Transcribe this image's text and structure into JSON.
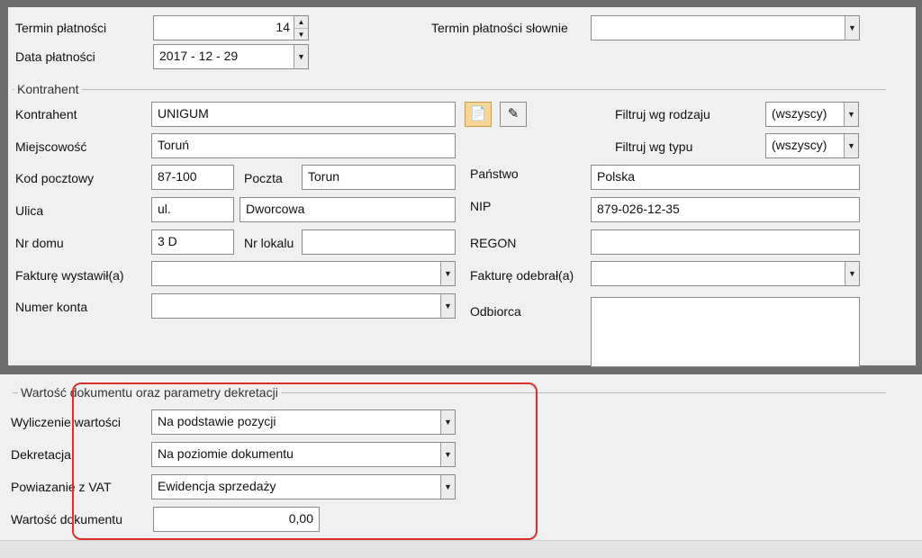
{
  "payment": {
    "term_label": "Termin płatności",
    "term_value": "14",
    "term_words_label": "Termin płatności słownie",
    "term_words_value": "",
    "date_label": "Data płatności",
    "date_value": "2017 - 12 - 29"
  },
  "contractor": {
    "group_title": "Kontrahent",
    "name_label": "Kontrahent",
    "name_value": "UNIGUM",
    "city_label": "Miejscowość",
    "city_value": "Toruń",
    "postcode_label": "Kod pocztowy",
    "postcode_value": "87-100",
    "post_label": "Poczta",
    "post_value": "Torun",
    "street_label": "Ulica",
    "street_prefix": "ul.",
    "street_value": "Dworcowa",
    "house_label": "Nr domu",
    "house_value": "3 D",
    "flat_label": "Nr lokalu",
    "flat_value": "",
    "issued_label": "Fakturę wystawił(a)",
    "issued_value": "",
    "account_label": "Numer konta",
    "account_value": "",
    "filter_kind_label": "Filtruj wg rodzaju",
    "filter_kind_value": "(wszyscy)",
    "filter_type_label": "Filtruj wg typu",
    "filter_type_value": "(wszyscy)",
    "country_label": "Państwo",
    "country_value": "Polska",
    "nip_label": "NIP",
    "nip_value": "879-026-12-35",
    "regon_label": "REGON",
    "regon_value": "",
    "received_label": "Fakturę odebrał(a)",
    "received_value": "",
    "recipient_label": "Odbiorca",
    "recipient_value": ""
  },
  "valuation": {
    "group_title": "Wartość dokumentu oraz parametry dekretacji",
    "calc_label": "Wyliczenie wartości",
    "calc_value": "Na podstawie pozycji",
    "posting_label": "Dekretacja",
    "posting_value": "Na poziomie dokumentu",
    "vat_label": "Powiazanie z VAT",
    "vat_value": "Ewidencja sprzedaży",
    "doc_value_label": "Wartość dokumentu",
    "doc_value": "0,00"
  },
  "colors": {
    "frame": "#6e6e6e",
    "highlight": "#d9302c",
    "active_button": "#f6d596"
  },
  "icons": {
    "select_contractor": "document-arrow-icon",
    "edit_contractor": "pencil-document-icon"
  }
}
